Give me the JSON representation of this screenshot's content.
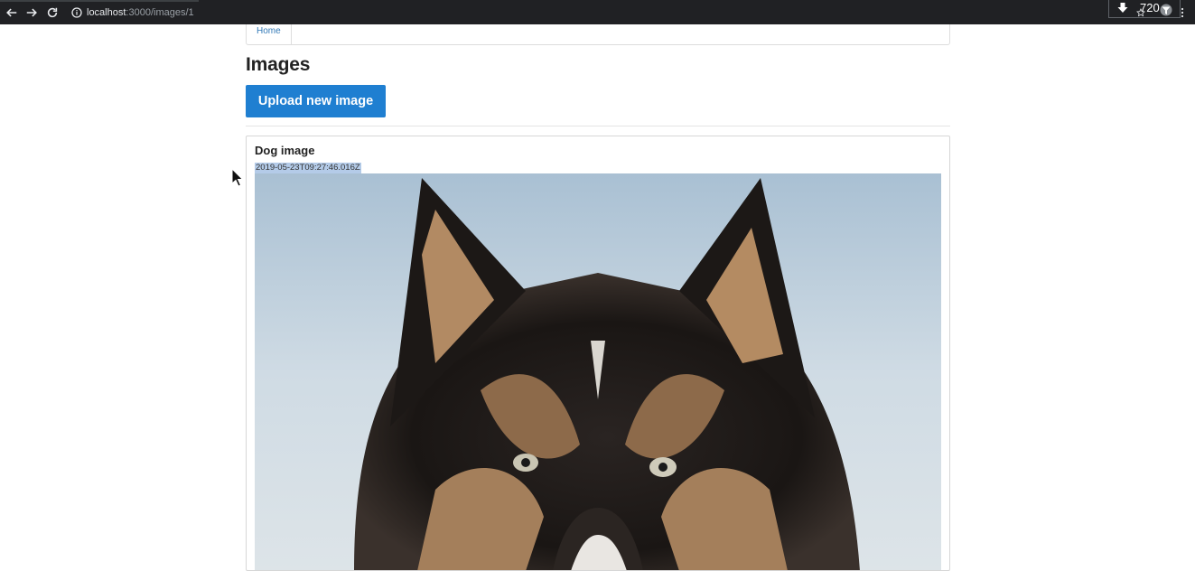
{
  "browser": {
    "url_host": "localhost",
    "url_path": ":3000/images/1",
    "extension_label": "720"
  },
  "nav": {
    "home_label": "Home"
  },
  "page": {
    "title": "Images",
    "upload_button_label": "Upload new image"
  },
  "images": [
    {
      "title": "Dog image",
      "created_at": "2019-05-23T09:27:46.016Z",
      "photo_subject": "dog-photo"
    }
  ],
  "colors": {
    "primary_button": "#1f7fd1",
    "link": "#337ab7",
    "selection": "#b4cbe8"
  },
  "icons": [
    "back-arrow-icon",
    "forward-arrow-icon",
    "reload-icon",
    "info-icon",
    "download-icon",
    "star-icon",
    "filter-icon",
    "kebab-menu-icon",
    "mouse-cursor-icon"
  ]
}
